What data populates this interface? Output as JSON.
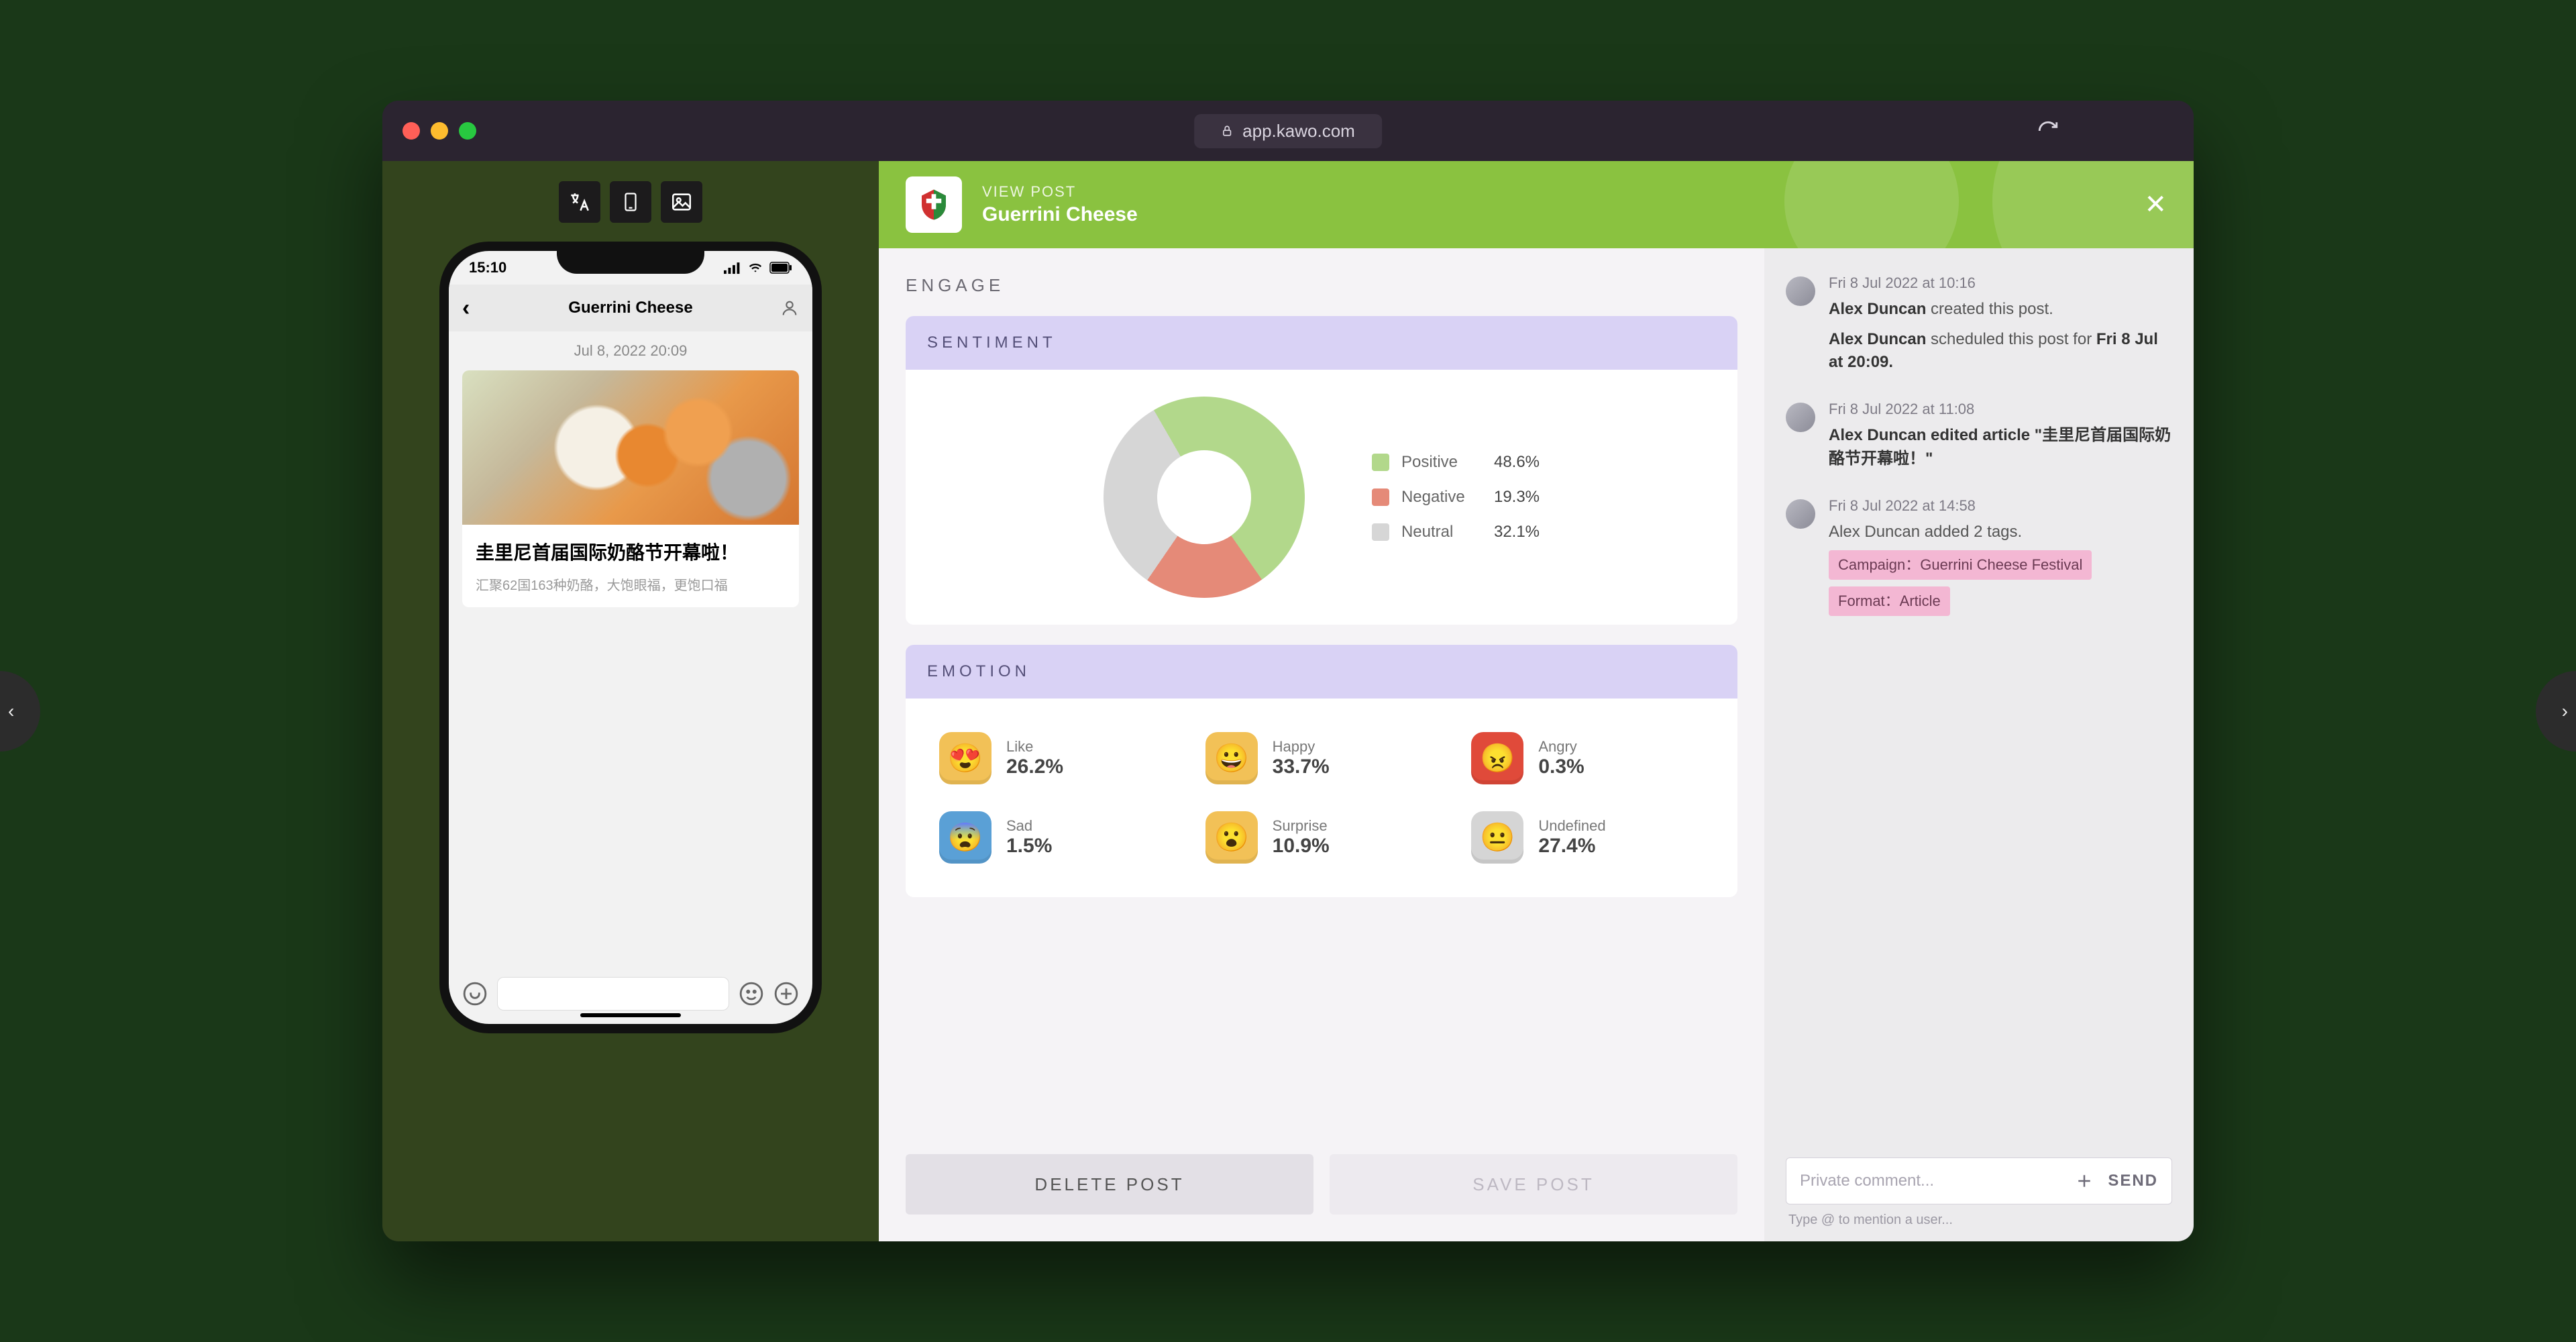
{
  "browser": {
    "url": "app.kawo.com"
  },
  "header": {
    "eyebrow": "VIEW POST",
    "title": "Guerrini Cheese"
  },
  "phone": {
    "time": "15:10",
    "nav_title": "Guerrini Cheese",
    "post_timestamp": "Jul 8, 2022 20:09",
    "article_title": "圭里尼首届国际奶酪节开幕啦！",
    "article_subtitle": "汇聚62国163种奶酪，大饱眼福，更饱口福"
  },
  "engage": {
    "section_label": "ENGAGE",
    "sentiment_label": "SENTIMENT",
    "emotion_label": "EMOTION",
    "sentiment": {
      "positive_label": "Positive",
      "positive_val": "48.6%",
      "negative_label": "Negative",
      "negative_val": "19.3%",
      "neutral_label": "Neutral",
      "neutral_val": "32.1%"
    },
    "emotions": {
      "like": {
        "label": "Like",
        "val": "26.2%",
        "bg": "#f2c157",
        "face": "😍"
      },
      "happy": {
        "label": "Happy",
        "val": "33.7%",
        "bg": "#f2c157",
        "face": "😀"
      },
      "angry": {
        "label": "Angry",
        "val": "0.3%",
        "bg": "#e04a3a",
        "face": "😠"
      },
      "sad": {
        "label": "Sad",
        "val": "1.5%",
        "bg": "#5aa0d6",
        "face": "😨"
      },
      "surprise": {
        "label": "Surprise",
        "val": "10.9%",
        "bg": "#f2c157",
        "face": "😮"
      },
      "undefined": {
        "label": "Undefined",
        "val": "27.4%",
        "bg": "#d5d5d5",
        "face": "😐"
      }
    },
    "delete_label": "DELETE POST",
    "save_label": "SAVE POST"
  },
  "feed": {
    "created": {
      "time": "Fri 8 Jul 2022 at 10:16",
      "user": "Alex Duncan",
      "action": "created this post."
    },
    "scheduled": {
      "user": "Alex Duncan",
      "action": "scheduled this post for",
      "when": "Fri 8 Jul at 20:09."
    },
    "edited": {
      "time": "Fri 8 Jul 2022 at 11:08",
      "text": "Alex Duncan edited article \"圭里尼首届国际奶酪节开幕啦！\""
    },
    "tagged": {
      "time": "Fri 8 Jul 2022 at 14:58",
      "text": "Alex Duncan added 2 tags.",
      "tag1": "Campaign：Guerrini Cheese Festival",
      "tag2": "Format：Article"
    },
    "comment_placeholder": "Private comment...",
    "send_label": "SEND",
    "hint": "Type @ to mention a user..."
  },
  "chart_data": {
    "type": "pie",
    "title": "Sentiment",
    "series": [
      {
        "name": "Positive",
        "value": 48.6,
        "color": "#b2d88b"
      },
      {
        "name": "Negative",
        "value": 19.3,
        "color": "#e58a78"
      },
      {
        "name": "Neutral",
        "value": 32.1,
        "color": "#d6d6d6"
      }
    ]
  }
}
